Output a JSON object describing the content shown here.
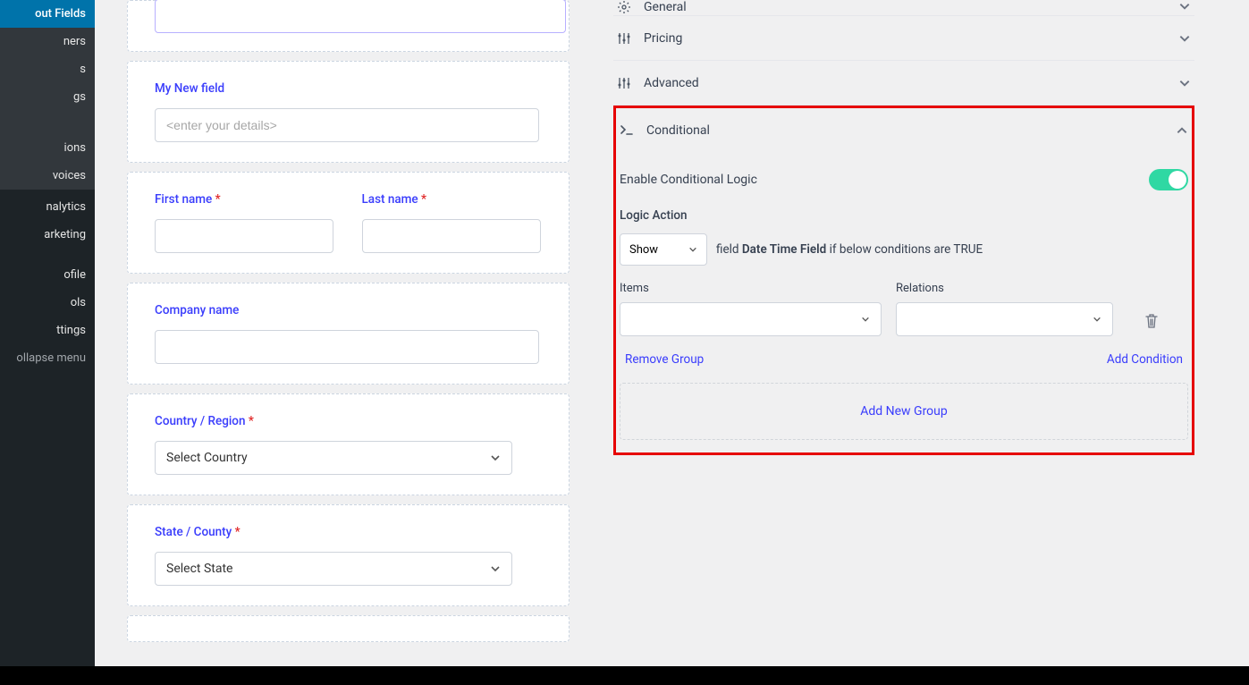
{
  "sidebar": {
    "checkout_fields": "out Fields",
    "items": [
      "ners",
      "s",
      "gs",
      "ions",
      "voices",
      "nalytics",
      "arketing",
      "ofile",
      "ols",
      "ttings",
      "ollapse menu"
    ]
  },
  "form": {
    "my_new_field": {
      "label": "My New field",
      "placeholder": "<enter your details>"
    },
    "first_name": {
      "label": "First name "
    },
    "last_name": {
      "label": "Last name "
    },
    "company": {
      "label": "Company name"
    },
    "country": {
      "label": "Country / Region ",
      "value": "Select Country"
    },
    "state": {
      "label": "State / County ",
      "value": "Select State"
    }
  },
  "panel": {
    "general": "General",
    "pricing": "Pricing",
    "advanced": "Advanced",
    "conditional": "Conditional",
    "enable_label": "Enable Conditional Logic",
    "logic_action_label": "Logic Action",
    "show": "Show",
    "logic_prefix": "field ",
    "field_name": "Date Time Field",
    "logic_suffix": " if below conditions are TRUE",
    "items_label": "Items",
    "relations_label": "Relations",
    "remove_group": "Remove Group",
    "add_condition": "Add Condition",
    "add_new_group": "Add New Group"
  },
  "req": "*"
}
